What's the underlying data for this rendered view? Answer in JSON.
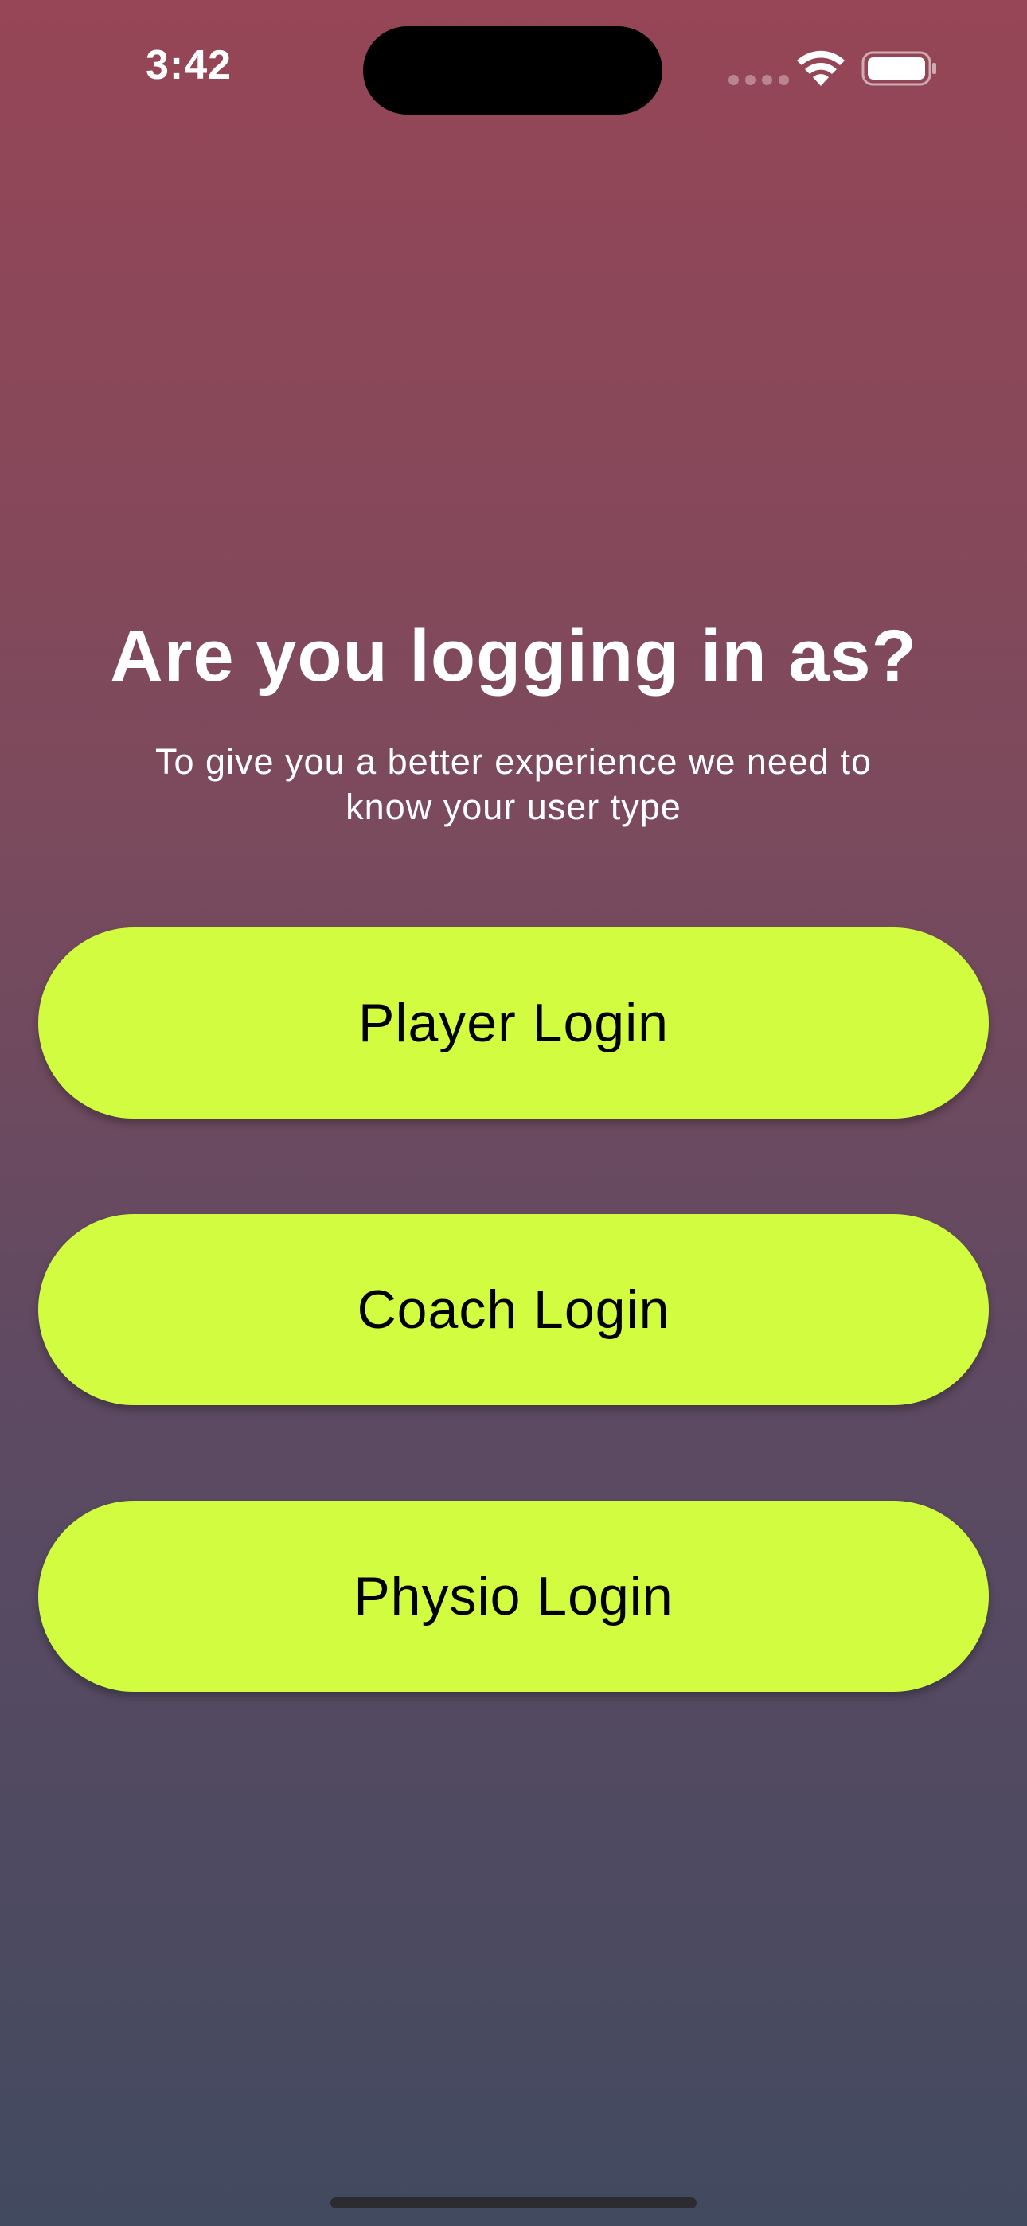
{
  "status_bar": {
    "time": "3:42",
    "icons": [
      "cellular-signal-icon",
      "wifi-icon",
      "battery-icon"
    ]
  },
  "heading": {
    "title": "Are you logging in as?",
    "subtitle": "To give you a better experience we need to know your user type"
  },
  "buttons": {
    "player": "Player Login",
    "coach": "Coach Login",
    "physio": "Physio Login"
  },
  "colors": {
    "accent": "#d1fc3f",
    "gradient_top": "#964656",
    "gradient_bottom": "#424a60"
  }
}
